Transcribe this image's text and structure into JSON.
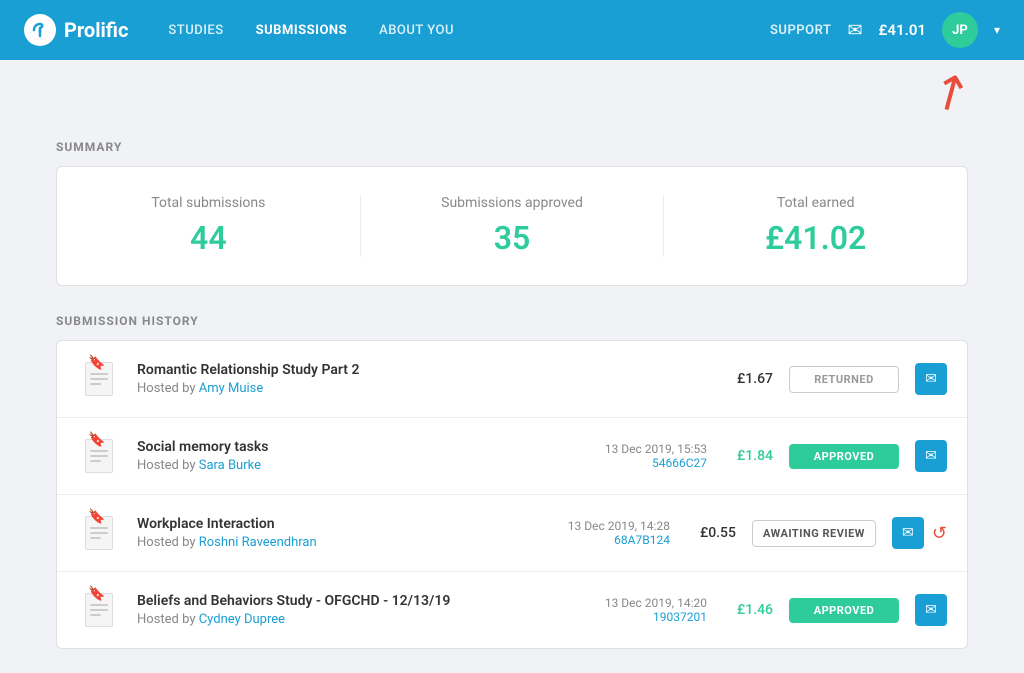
{
  "nav": {
    "logo_text": "Prolific",
    "logo_initials": "p",
    "links": [
      {
        "label": "STUDIES",
        "active": false
      },
      {
        "label": "SUBMISSIONS",
        "active": true
      },
      {
        "label": "ABOUT YOU",
        "active": false
      }
    ],
    "support_label": "SUPPORT",
    "balance": "£41.01",
    "avatar_initials": "JP",
    "chevron": "▾"
  },
  "summary": {
    "section_label": "SUMMARY",
    "items": [
      {
        "label": "Total submissions",
        "value": "44"
      },
      {
        "label": "Submissions approved",
        "value": "35"
      },
      {
        "label": "Total earned",
        "value": "£41.02"
      }
    ]
  },
  "history": {
    "section_label": "SUBMISSION HISTORY",
    "rows": [
      {
        "name": "Romantic Relationship Study Part 2",
        "host": "Amy Muise",
        "date": "",
        "id": "",
        "amount": "£1.67",
        "amount_green": false,
        "status": "RETURNED",
        "status_type": "returned"
      },
      {
        "name": "Social memory tasks",
        "host": "Sara Burke",
        "date": "13 Dec 2019, 15:53",
        "id": "54666C27",
        "amount": "£1.84",
        "amount_green": true,
        "status": "APPROVED",
        "status_type": "approved"
      },
      {
        "name": "Workplace Interaction",
        "host": "Roshni Raveendhran",
        "date": "13 Dec 2019, 14:28",
        "id": "68A7B124",
        "amount": "£0.55",
        "amount_green": false,
        "status": "AWAITING REVIEW",
        "status_type": "awaiting"
      },
      {
        "name": "Beliefs and Behaviors Study - OFGCHD - 12/13/19",
        "host": "Cydney Dupree",
        "date": "13 Dec 2019, 14:20",
        "id": "19037201",
        "amount": "£1.46",
        "amount_green": true,
        "status": "APPROVED",
        "status_type": "approved"
      }
    ]
  }
}
